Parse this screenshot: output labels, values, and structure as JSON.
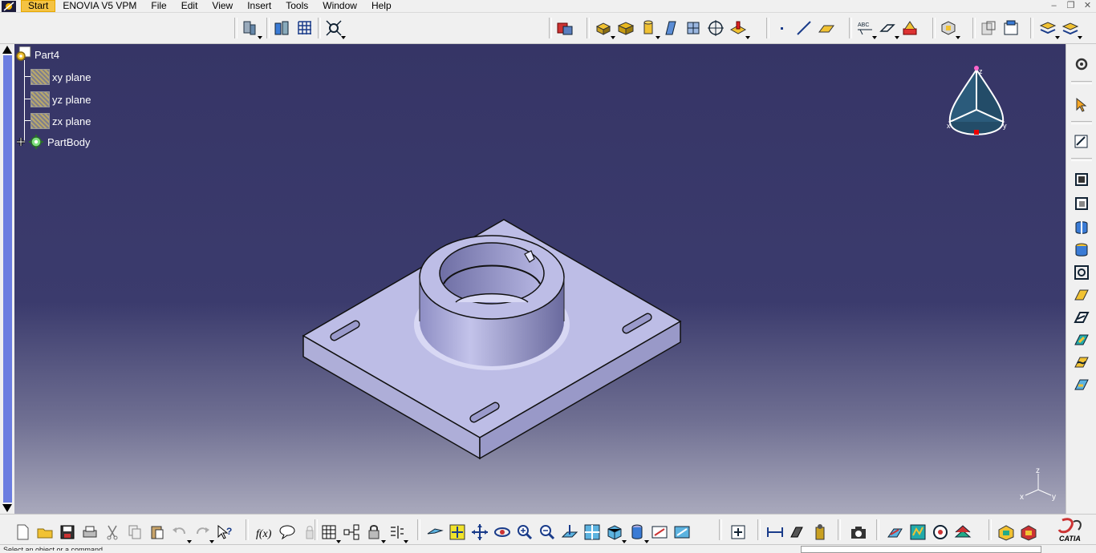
{
  "menubar": {
    "items": [
      "Start",
      "ENOVIA V5 VPM",
      "File",
      "Edit",
      "View",
      "Insert",
      "Tools",
      "Window",
      "Help"
    ]
  },
  "tree": {
    "root": "Part4",
    "children": [
      "xy plane",
      "yz plane",
      "zx plane",
      "PartBody"
    ]
  },
  "compass": {
    "axis_z": "z",
    "axis_x": "x",
    "axis_y": "y"
  },
  "axis_triad": {
    "z": "z",
    "x": "x",
    "y": "y"
  },
  "colors": {
    "accent_menu": "#f5c342",
    "viewport_top": "#363566",
    "viewport_bottom": "#a9a9bc",
    "part_face": "#b8b8e0"
  },
  "status": {
    "text": "Select an object or a command"
  },
  "brand": {
    "logo_text": "CATIA"
  }
}
